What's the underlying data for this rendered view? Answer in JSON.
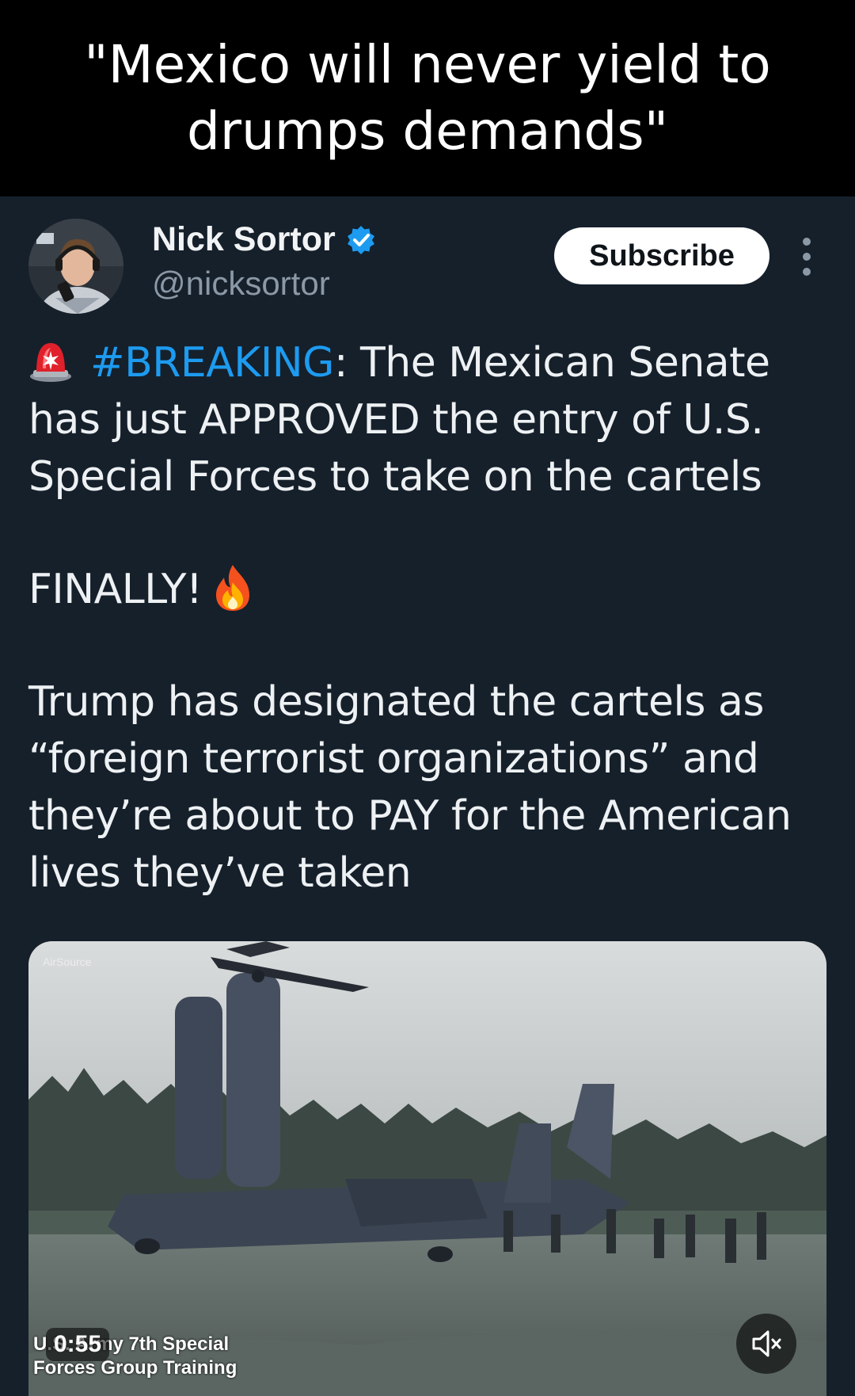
{
  "banner": {
    "caption": "\"Mexico will never yield to drumps demands\""
  },
  "post": {
    "author": {
      "name": "Nick Sortor",
      "handle": "@nicksortor"
    },
    "subscribe_label": "Subscribe",
    "text": {
      "hashtag": "#BREAKING",
      "line1_rest": ": The Mexican Senate has just APPROVED the entry of U.S. Special Forces to take on the cartels",
      "exclamation": "FINALLY!",
      "paragraph3": "Trump has designated the cartels as “foreign terrorist organizations” and they’re about to PAY for the American lives they’ve taken"
    },
    "media": {
      "watermark": "AirSource",
      "duration": "0:55",
      "caption": "U.S. Army 7th Special Forces Group Training"
    }
  },
  "colors": {
    "background": "#15202b",
    "banner": "#000000",
    "hashtag": "#1d9bf0",
    "verified": "#1d9bf0",
    "handle": "#8b98a5"
  },
  "icons": {
    "verified": "verified-badge-icon",
    "more": "more-vertical-icon",
    "siren": "siren-emoji",
    "fire": "fire-emoji",
    "mute": "volume-muted-icon"
  }
}
